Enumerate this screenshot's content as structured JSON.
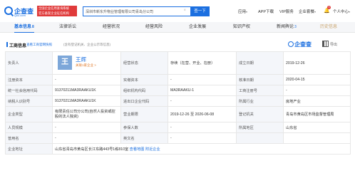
{
  "header": {
    "logo_text": "企查查",
    "logo_sub": "Qcc.com",
    "slogan_line1": "全国企业信用查询系统",
    "slogan_line2": "官方备案企业征信机构",
    "search_value": "深圳市新东升物业管理有限公司青岛分公司",
    "search_button": "查一下",
    "nav": [
      "应用",
      "APP下载",
      "VIP服务",
      "企业套餐"
    ],
    "user": "个人中心",
    "notification_count": "3"
  },
  "tabs": [
    {
      "label": "基本信息",
      "count": "8"
    },
    {
      "label": "法律诉讼",
      "count": ""
    },
    {
      "label": "经营状况",
      "count": ""
    },
    {
      "label": "经营风险",
      "count": ""
    },
    {
      "label": "企业发展",
      "count": ""
    },
    {
      "label": "知识产权",
      "count": ""
    },
    {
      "label": "新闻舆论",
      "count": "3"
    },
    {
      "label": "历史信息",
      "count": ""
    }
  ],
  "section": {
    "title": "工商信息",
    "link1": "查看工商官网快照",
    "link2": "(含有登记机关、企业公示等信息)",
    "brand": "企查查",
    "qr_label": "导出"
  },
  "person": {
    "avatar_char": "王",
    "name": "王辉",
    "related": "关联1家企业 >"
  },
  "rows": [
    {
      "l1": "负责人",
      "v1": "",
      "l2": "经营状态",
      "v2": "存续（在营、开业、在册）",
      "l3": "成立日期",
      "v3": "2019-12-26"
    },
    {
      "l1": "注册资本",
      "v1": "-",
      "l2": "实缴资本",
      "v2": "-",
      "l3": "核准日期",
      "v3": "2020-04-15"
    },
    {
      "l1": "统一社会信用代码",
      "v1": "91370211MA3RAAKU1K",
      "l2": "组织机构代码",
      "v2": "MA3RAAKU-1",
      "l3": "工商注册号",
      "v3": "-"
    },
    {
      "l1": "纳税人识别号",
      "v1": "91370211MA3RAAKU1K",
      "l2": "进出口企业代码",
      "v2": "-",
      "l3": "所属行业",
      "v3": "房地产业"
    },
    {
      "l1": "企业类型",
      "v1": "有限责任公司分公司(自然人投资或控股的法人独资)",
      "l2": "营业期限",
      "v2": "2019-12-26 至 2026-06-08",
      "l3": "登记机关",
      "v3": "青岛市黄岛区市场监督管理局"
    },
    {
      "l1": "人员规模",
      "v1": "-",
      "l2": "参保人数",
      "v2": "-",
      "l3": "所属地区",
      "v3": "山东省"
    },
    {
      "l1": "曾用名",
      "v1": "-",
      "l2": "英文名",
      "v2": "-",
      "l3": "",
      "v3": ""
    },
    {
      "l1": "企业地址",
      "v1": "山东省青岛市黄岛区长江东路443号1栋810室",
      "addr_link1": "查看地图",
      "addr_link2": "附近企业",
      "l2": "",
      "v2": "",
      "l3": "",
      "v3": ""
    }
  ]
}
